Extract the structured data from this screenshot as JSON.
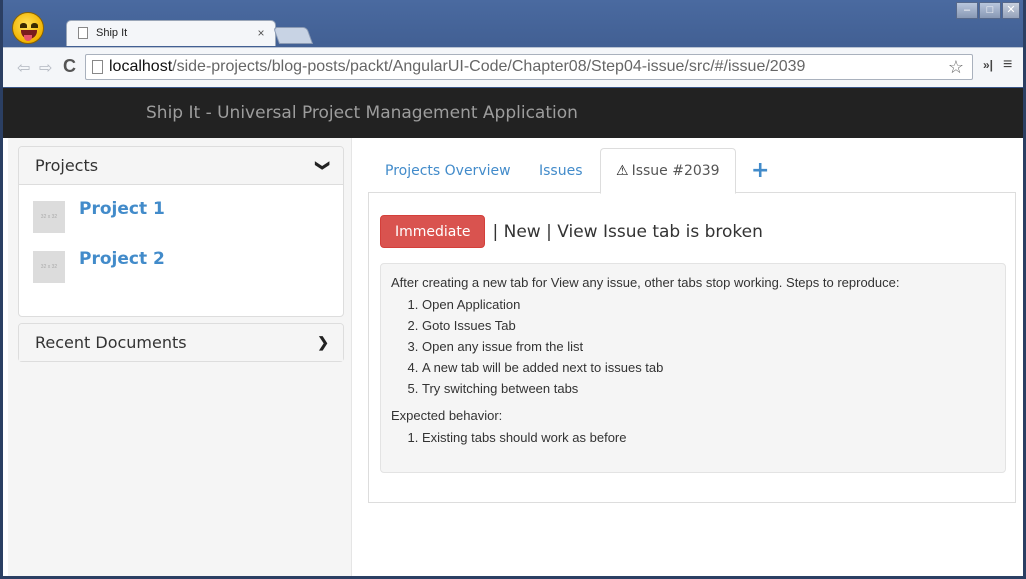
{
  "browser": {
    "tab_title": "Ship It",
    "tab_close": "×",
    "url_host": "localhost",
    "url_path": "/side-projects/blog-posts/packt/AngularUI-Code/Chapter08/Step04-issue/src/#/issue/2039",
    "window_controls": {
      "minimize": "–",
      "maximize": "□",
      "close": "✕"
    },
    "icons": {
      "back": "⇦",
      "forward": "⇨",
      "reload": "C",
      "bookmark": "☆",
      "extensions": "»|",
      "menu": "≡"
    }
  },
  "navbar": {
    "brand": "Ship It - Universal Project Management Application"
  },
  "sidebar": {
    "projects_panel": {
      "title": "Projects",
      "chevron": "❯",
      "items": [
        {
          "thumb": "32 x 32",
          "name": "Project 1"
        },
        {
          "thumb": "32 x 32",
          "name": "Project 2"
        }
      ]
    },
    "recent_panel": {
      "title": "Recent Documents",
      "chevron": "❯"
    }
  },
  "tabs": {
    "items": [
      {
        "label": "Projects Overview"
      },
      {
        "label": "Issues"
      },
      {
        "label": "Issue #2039",
        "icon": "⚠"
      }
    ],
    "add": "+"
  },
  "issue": {
    "priority": "Immediate",
    "title": "| New | View Issue tab is broken",
    "description": "After creating a new tab for View any issue, other tabs stop working. Steps to reproduce:",
    "steps": [
      "Open Application",
      "Goto Issues Tab",
      "Open any issue from the list",
      "A new tab will be added next to issues tab",
      "Try switching between tabs"
    ],
    "expected_label": "Expected behavior:",
    "expected": [
      "Existing tabs should work as before"
    ]
  },
  "colors": {
    "navbar_bg": "#222222",
    "link": "#428bca",
    "danger": "#d9534f",
    "chrome": "#3e5b8c"
  }
}
